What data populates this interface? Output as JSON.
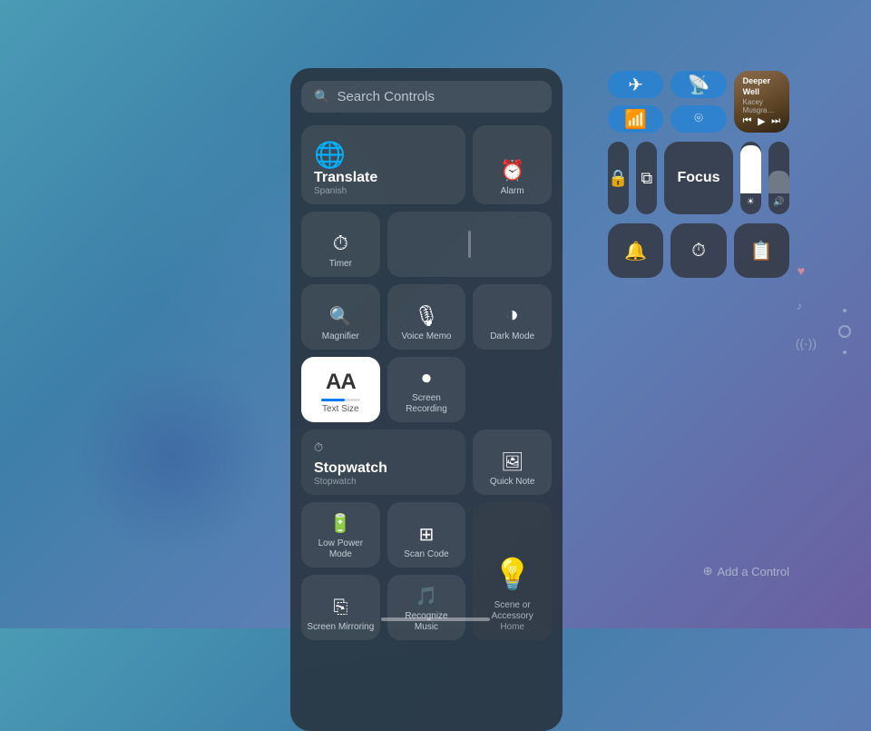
{
  "background": {
    "gradient": "linear-gradient(135deg, #4a9bb5, #3d7fa8, #5b7fb5, #6b5fa0)"
  },
  "search_panel": {
    "search_bar": {
      "placeholder": "Search Controls",
      "icon": "🔍"
    },
    "controls": [
      {
        "id": "translate",
        "label": "Translate",
        "sublabel": "Spanish",
        "icon": "🌐",
        "type": "wide",
        "row": 1
      },
      {
        "id": "alarm",
        "label": "Alarm",
        "icon": "⏰",
        "type": "normal",
        "row": 1
      },
      {
        "id": "timer",
        "label": "Timer",
        "icon": "⏱",
        "type": "normal",
        "row": 1
      },
      {
        "id": "magnifier",
        "label": "Magnifier",
        "icon": "🔍",
        "type": "normal",
        "row": 2
      },
      {
        "id": "voice-memo",
        "label": "Voice Memo",
        "icon": "🎙",
        "type": "normal",
        "row": 3
      },
      {
        "id": "dark-mode",
        "label": "Dark Mode",
        "icon": "◑",
        "type": "normal",
        "row": 3
      },
      {
        "id": "text-size",
        "label": "Text Size",
        "icon": "AA",
        "type": "text-size",
        "row": 3
      },
      {
        "id": "screen-recording",
        "label": "Screen Recording",
        "icon": "⏺",
        "type": "normal",
        "row": 3
      },
      {
        "id": "stopwatch",
        "label": "Stopwatch",
        "icon": "⏱",
        "type": "wide",
        "row": 4
      },
      {
        "id": "quick-note",
        "label": "Quick Note",
        "icon": "🖼",
        "type": "normal",
        "row": 4
      },
      {
        "id": "low-power-mode",
        "label": "Low Power Mode",
        "icon": "🔋",
        "type": "normal",
        "row": 4
      },
      {
        "id": "scan-code",
        "label": "Scan Code",
        "icon": "⊞",
        "type": "normal",
        "row": 5
      },
      {
        "id": "home",
        "label": "Home",
        "sublabel": "Scene or Accessory",
        "icon": "💡",
        "type": "home-wide",
        "row": 5
      },
      {
        "id": "screen-mirroring",
        "label": "Screen Mirroring",
        "icon": "⎘",
        "type": "normal",
        "row": 5
      },
      {
        "id": "recognize-music",
        "label": "Recognize Music",
        "icon": "🎵",
        "type": "normal",
        "row": 6
      }
    ]
  },
  "right_panel": {
    "media_row": [
      {
        "id": "airplane-mode",
        "label": "",
        "icon": "✈",
        "active": true
      },
      {
        "id": "wifi-toggle",
        "label": "",
        "icon": "📡",
        "active": true
      },
      {
        "id": "now-playing",
        "label": "",
        "type": "now-playing",
        "title": "Deeper Well",
        "artist": "Kacey Musgra…"
      }
    ],
    "media_controls_row": [
      {
        "id": "rewind",
        "icon": "⏮"
      },
      {
        "id": "play-pause",
        "icon": "▶"
      },
      {
        "id": "fast-forward",
        "icon": "⏭"
      }
    ],
    "row2": [
      {
        "id": "bluetooth",
        "icon": "⌦",
        "active": true
      },
      {
        "id": "screen-mirror",
        "icon": "⎘",
        "active": true
      },
      {
        "id": "focus",
        "label": "Focus",
        "type": "wide"
      },
      {
        "id": "brightness",
        "type": "slider"
      },
      {
        "id": "volume",
        "type": "slider"
      }
    ],
    "row3": [
      {
        "id": "mute",
        "icon": "🔔"
      },
      {
        "id": "timer-r",
        "icon": "⏱"
      },
      {
        "id": "notes",
        "icon": "📋"
      }
    ],
    "add_control": {
      "label": "Add a Control",
      "icon": "⊕"
    }
  }
}
